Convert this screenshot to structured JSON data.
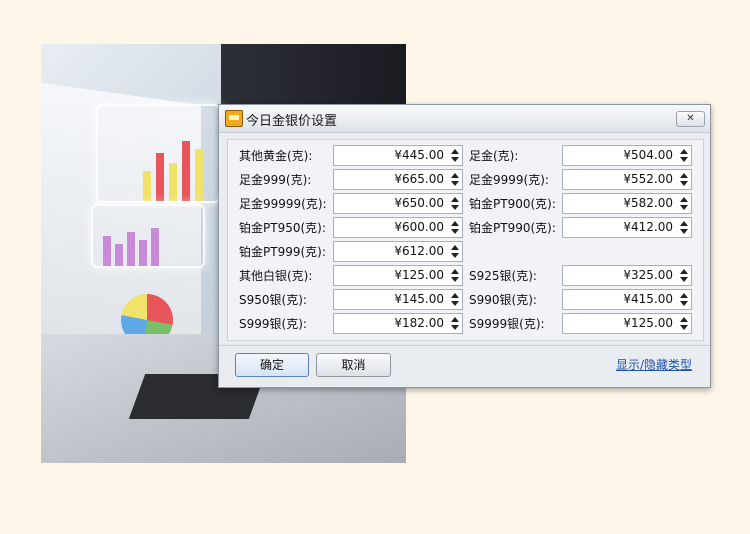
{
  "dialog": {
    "title": "今日金银价设置",
    "close_label": "✕",
    "fields": [
      {
        "label": "其他黄金(克):",
        "value": "¥445.00"
      },
      {
        "label": "足金(克):",
        "value": "¥504.00"
      },
      {
        "label": "足金999(克):",
        "value": "¥665.00"
      },
      {
        "label": "足金9999(克):",
        "value": "¥552.00"
      },
      {
        "label": "足金99999(克):",
        "value": "¥650.00"
      },
      {
        "label": "铂金PT900(克):",
        "value": "¥582.00"
      },
      {
        "label": "铂金PT950(克):",
        "value": "¥600.00"
      },
      {
        "label": "铂金PT990(克):",
        "value": "¥412.00"
      },
      {
        "label": "铂金PT999(克):",
        "value": "¥612.00"
      },
      {
        "label": "其他白银(克):",
        "value": "¥125.00"
      },
      {
        "label": "S925银(克):",
        "value": "¥325.00"
      },
      {
        "label": "S950银(克):",
        "value": "¥145.00"
      },
      {
        "label": "S990银(克):",
        "value": "¥415.00"
      },
      {
        "label": "S999银(克):",
        "value": "¥182.00"
      },
      {
        "label": "S9999银(克):",
        "value": "¥125.00"
      }
    ],
    "ok_label": "确定",
    "cancel_label": "取消",
    "toggle_link": "显示/隐藏类型"
  }
}
